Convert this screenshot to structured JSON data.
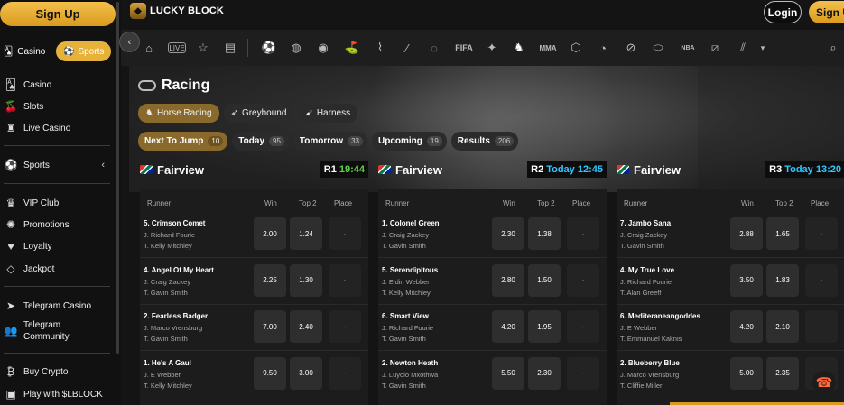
{
  "sidebar": {
    "signup_label": "Sign Up",
    "toggle": {
      "casino": "Casino",
      "sports": "Sports"
    },
    "items": [
      {
        "label": "Casino",
        "icon": "cards-icon"
      },
      {
        "label": "Slots",
        "icon": "cherries-icon"
      },
      {
        "label": "Live Casino",
        "icon": "dealer-icon"
      },
      {
        "label": "Sports",
        "icon": "football-icon"
      },
      {
        "label": "VIP Club",
        "icon": "crown-icon"
      },
      {
        "label": "Promotions",
        "icon": "megaphone-icon"
      },
      {
        "label": "Loyalty",
        "icon": "hand-heart-icon"
      },
      {
        "label": "Jackpot",
        "icon": "diamond-icon"
      },
      {
        "label": "Telegram Casino",
        "icon": "telegram-icon"
      },
      {
        "label": "Telegram Community",
        "label_line1": "Telegram",
        "label_line2": "Community",
        "icon": "people-icon"
      },
      {
        "label": "Buy Crypto",
        "icon": "bitcoin-icon"
      },
      {
        "label": "Play with $LBLOCK",
        "icon": "wallet-icon"
      }
    ]
  },
  "header": {
    "logo_text": "LUCKY BLOCK",
    "login_label": "Login",
    "signup_label": "Sign U"
  },
  "sportnav": {
    "icons": [
      "home-icon",
      "live-icon",
      "star-icon",
      "betslip-icon",
      "soccer-icon",
      "tennis-icon",
      "basketball-icon",
      "golf-icon",
      "cricket-icon",
      "baseball-icon",
      "hockey-icon",
      "fifa-icon",
      "counter-strike-icon",
      "horse-racing-icon",
      "mma-icon",
      "handball-icon",
      "volleyball-icon",
      "table-tennis-icon",
      "rugby-icon",
      "nba2k-icon",
      "esports-icon",
      "more-sports-icon",
      "chevron-down-icon",
      "search-icon"
    ],
    "fifa_text": "FIFA",
    "mma_text": "MMA",
    "nba_text": "NBA"
  },
  "racing": {
    "title": "Racing",
    "types": [
      {
        "label": "Horse Racing",
        "icon": "horse-icon",
        "active": true
      },
      {
        "label": "Greyhound",
        "icon": "greyhound-icon",
        "active": false
      },
      {
        "label": "Harness",
        "icon": "harness-icon",
        "active": false
      }
    ],
    "filters": [
      {
        "label": "Next To Jump",
        "count": "10",
        "active": true
      },
      {
        "label": "Today",
        "count": "95",
        "active": false
      },
      {
        "label": "Tomorrow",
        "count": "33",
        "active": false
      },
      {
        "label": "Upcoming",
        "count": "19",
        "active": false
      },
      {
        "label": "Results",
        "count": "206",
        "active": false
      }
    ]
  },
  "columns": {
    "runner": "Runner",
    "win": "Win",
    "top2": "Top 2",
    "place": "Place"
  },
  "races": [
    {
      "venue": "Fairview",
      "race": "R1",
      "time": "19:44",
      "time_color": "#5fd24a",
      "runners": [
        {
          "name": "5. Crimson Comet",
          "jockey": "J. Richard Fourie",
          "trainer": "T. Kelly Mitchley",
          "win": "2.00",
          "top2": "1.24",
          "place": "-"
        },
        {
          "name": "4. Angel Of My Heart",
          "jockey": "J. Craig Zackey",
          "trainer": "T. Gavin Smith",
          "win": "2.25",
          "top2": "1.30",
          "place": "-"
        },
        {
          "name": "2. Fearless Badger",
          "jockey": "J. Marco Vrensburg",
          "trainer": "T. Gavin Smith",
          "win": "7.00",
          "top2": "2.40",
          "place": "-"
        },
        {
          "name": "1. He's A Gaul",
          "jockey": "J. E Webber",
          "trainer": "T. Kelly Mitchley",
          "win": "9.50",
          "top2": "3.00",
          "place": "-"
        }
      ]
    },
    {
      "venue": "Fairview",
      "race": "R2",
      "time": "Today 12:45",
      "time_color": "#2fc7ff",
      "runners": [
        {
          "name": "1. Colonel Green",
          "jockey": "J. Craig Zackey",
          "trainer": "T. Gavin Smith",
          "win": "2.30",
          "top2": "1.38",
          "place": "-"
        },
        {
          "name": "5. Serendipitous",
          "jockey": "J. Eldin Webber",
          "trainer": "T. Kelly Mitchley",
          "win": "2.80",
          "top2": "1.50",
          "place": "-"
        },
        {
          "name": "6. Smart View",
          "jockey": "J. Richard Fourie",
          "trainer": "T. Gavin Smith",
          "win": "4.20",
          "top2": "1.95",
          "place": "-"
        },
        {
          "name": "2. Newton Heath",
          "jockey": "J. Luyolo Mxothwa",
          "trainer": "T. Gavin Smith",
          "win": "5.50",
          "top2": "2.30",
          "place": "-"
        }
      ]
    },
    {
      "venue": "Fairview",
      "race": "R3",
      "time": "Today 13:20",
      "time_color": "#2fc7ff",
      "runners": [
        {
          "name": "7. Jambo Sana",
          "jockey": "J. Craig Zackey",
          "trainer": "T. Gavin Smith",
          "win": "2.88",
          "top2": "1.65",
          "place": "-"
        },
        {
          "name": "4. My True Love",
          "jockey": "J. Richard Fourie",
          "trainer": "T. Alan Greeff",
          "win": "3.50",
          "top2": "1.83",
          "place": "-"
        },
        {
          "name": "6. Mediteraneangoddes",
          "jockey": "J. E Webber",
          "trainer": "T. Emmanuel Kaknis",
          "win": "4.20",
          "top2": "2.10",
          "place": "-"
        },
        {
          "name": "2. Blueberry Blue",
          "jockey": "J. Marco Vrensburg",
          "trainer": "T. Cliffie Miller",
          "win": "5.00",
          "top2": "2.35",
          "place": "-"
        }
      ]
    }
  ],
  "colors": {
    "brand_gold": "#e7b23a",
    "active_tab": "#8a6a2c",
    "time_blue": "#2fc7ff",
    "time_green": "#5fd24a"
  }
}
